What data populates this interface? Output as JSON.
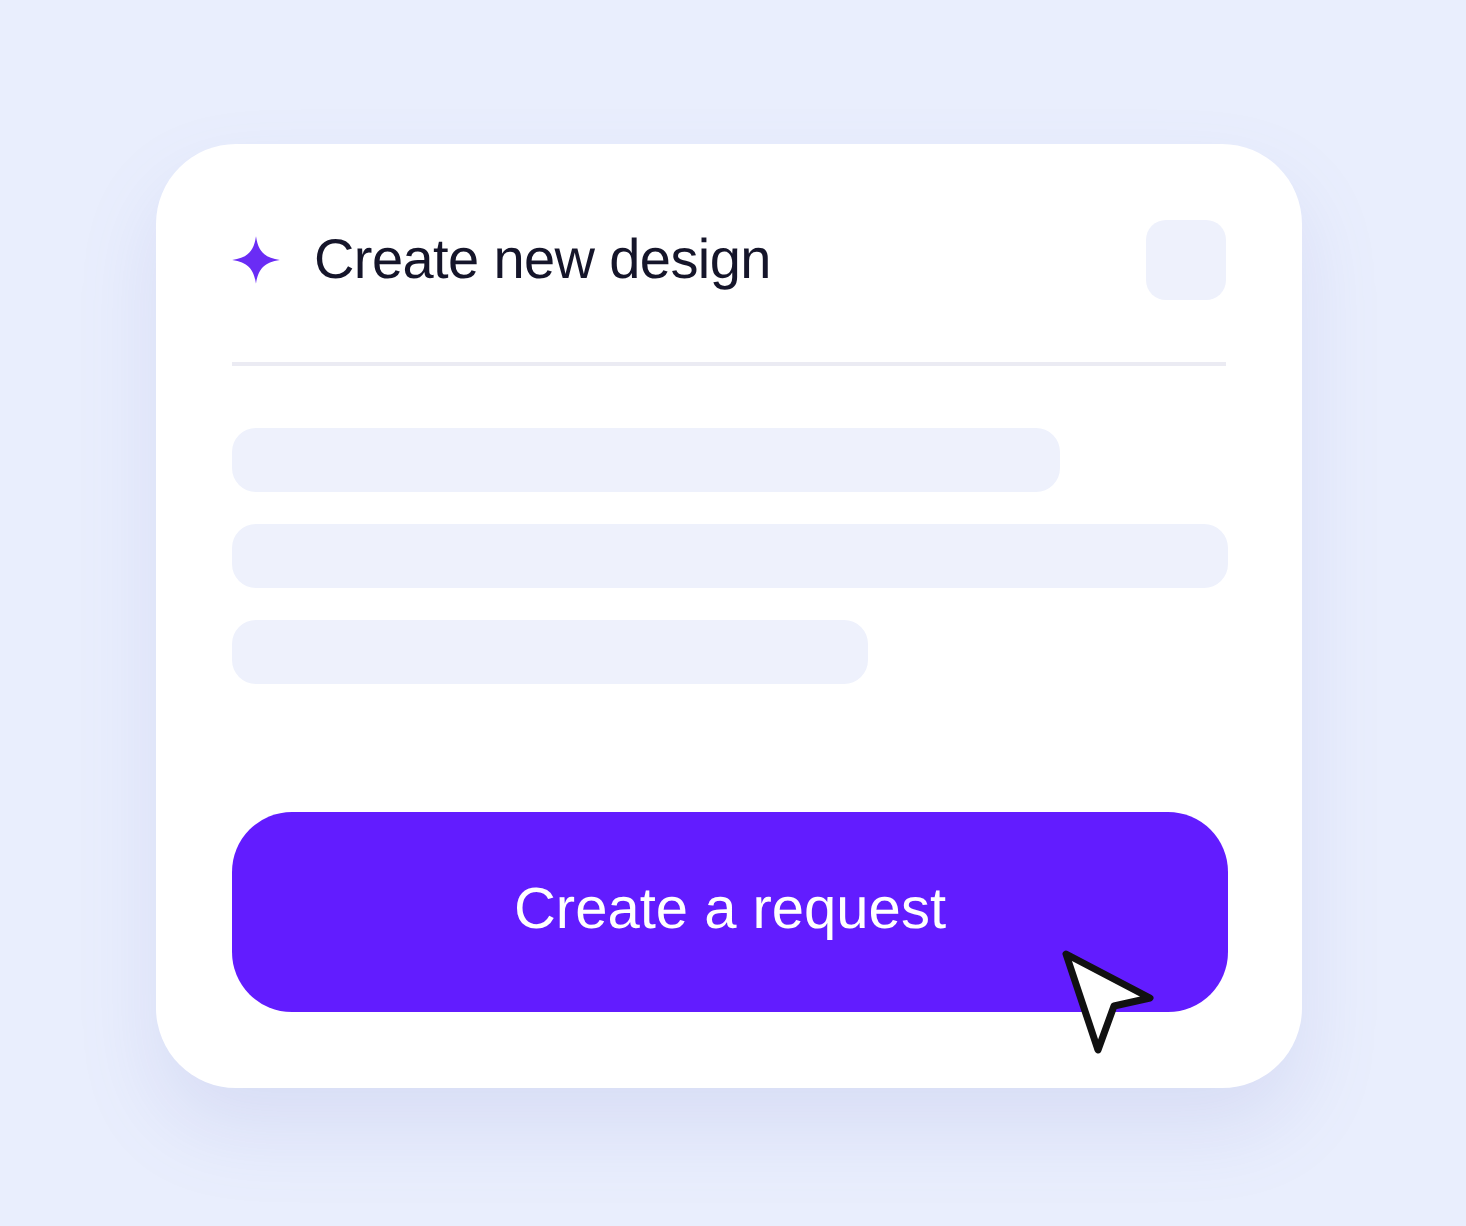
{
  "card": {
    "title": "Create new design"
  },
  "button": {
    "label": "Create a request"
  }
}
